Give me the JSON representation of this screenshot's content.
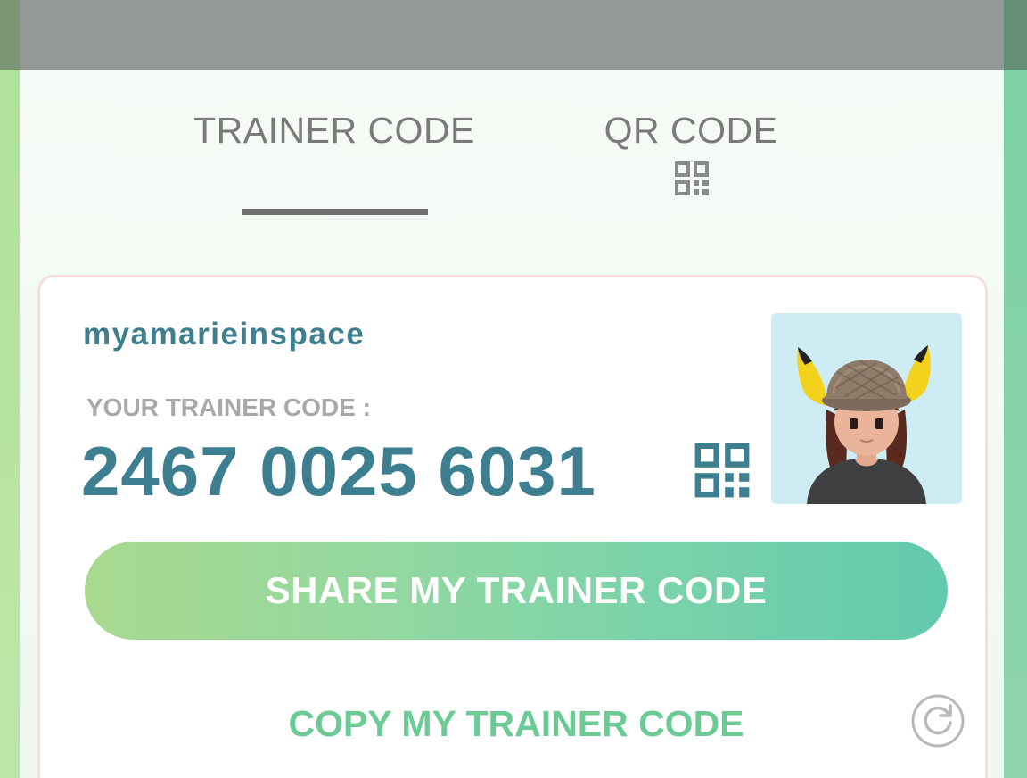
{
  "tabs": [
    {
      "label": "TRAINER CODE",
      "active": true
    },
    {
      "label": "QR CODE",
      "active": false
    }
  ],
  "profile": {
    "username": "myamarieinspace",
    "code_label": "YOUR TRAINER CODE :",
    "trainer_code": "2467 0025 6031"
  },
  "actions": {
    "share_label": "SHARE MY TRAINER CODE",
    "copy_label": "COPY MY TRAINER CODE"
  },
  "icons": {
    "tab_qr": "qr-code-icon",
    "card_qr": "qr-code-icon",
    "refresh": "refresh-icon",
    "avatar": "trainer-avatar"
  },
  "colors": {
    "accent_teal": "#3d7f90",
    "share_gradient_start": "#a9d98f",
    "share_gradient_end": "#63c9ad",
    "copy_green": "#6ccb95",
    "tab_text": "#7a7a7a"
  }
}
